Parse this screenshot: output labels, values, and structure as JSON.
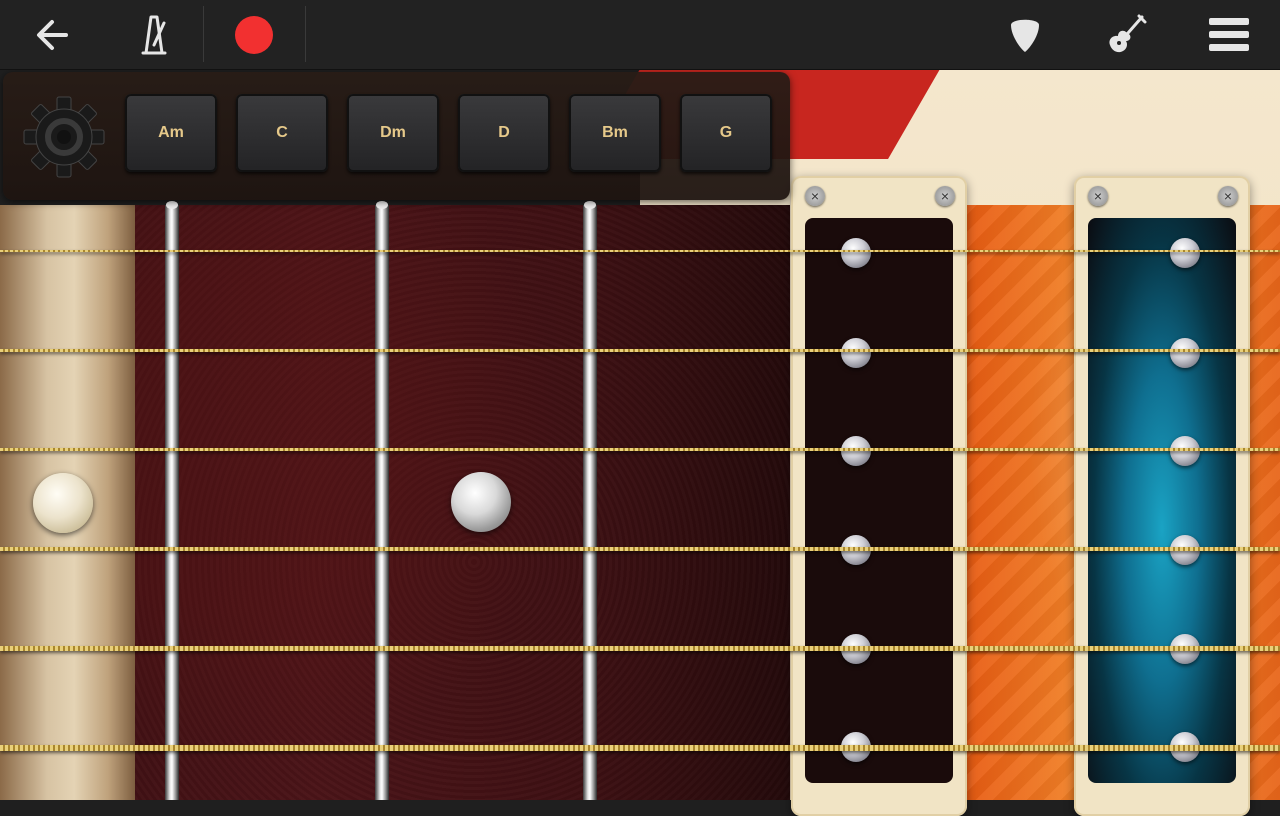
{
  "toolbar": {
    "back_icon": "arrow-left-icon",
    "metronome_icon": "metronome-icon",
    "record_icon": "record-dot-icon",
    "record_color": "#f23030",
    "pick_icon": "guitar-pick-icon",
    "guitar_icon": "electric-guitar-icon",
    "menu_icon": "hamburger-menu-icon"
  },
  "chord_panel": {
    "settings_icon": "gear-icon",
    "chords": [
      {
        "label": "Am"
      },
      {
        "label": "C"
      },
      {
        "label": "Dm"
      },
      {
        "label": "D"
      },
      {
        "label": "Bm"
      },
      {
        "label": "G"
      }
    ]
  },
  "fretboard": {
    "strings_count": 6,
    "frets_visible": 3
  },
  "pickups": {
    "count": 2,
    "active_glow_color": "#1aa3c4"
  }
}
